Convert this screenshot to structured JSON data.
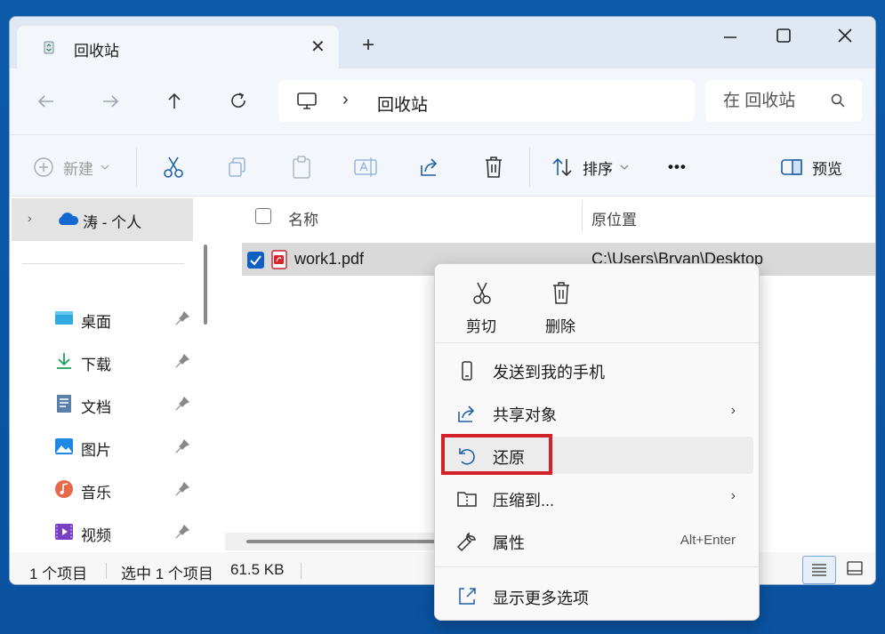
{
  "window": {
    "tab_title": "回收站",
    "tab_close": "✕",
    "new_tab": "+"
  },
  "address": {
    "crumb_sep": "›",
    "crumb": "回收站",
    "search_placeholder": "在 回收站"
  },
  "toolbar": {
    "new_label": "新建",
    "sort_label": "排序",
    "more_label": "•••",
    "preview_label": "预览"
  },
  "sidebar": {
    "onedrive_label": "涛 - 个人",
    "items": [
      {
        "label": "桌面",
        "icon": "desktop-icon"
      },
      {
        "label": "下载",
        "icon": "download-icon"
      },
      {
        "label": "文档",
        "icon": "documents-icon"
      },
      {
        "label": "图片",
        "icon": "pictures-icon"
      },
      {
        "label": "音乐",
        "icon": "music-icon"
      },
      {
        "label": "视频",
        "icon": "videos-icon"
      }
    ]
  },
  "columns": {
    "name": "名称",
    "original_location": "原位置"
  },
  "files": [
    {
      "name": "work1.pdf",
      "location": "C:\\Users\\Bryan\\Desktop",
      "selected": true
    }
  ],
  "status": {
    "item_count": "1 个项目",
    "selection": "选中 1 个项目",
    "size": "61.5 KB"
  },
  "context_menu": {
    "quick_actions": [
      {
        "label": "剪切",
        "icon": "scissors-icon"
      },
      {
        "label": "删除",
        "icon": "trash-icon"
      }
    ],
    "items": [
      {
        "label": "发送到我的手机",
        "icon": "phone-icon"
      },
      {
        "label": "共享对象",
        "icon": "share-icon",
        "arrow": "›"
      },
      {
        "label": "还原",
        "icon": "restore-icon"
      },
      {
        "label": "压缩到...",
        "icon": "zip-folder-icon",
        "arrow": "›"
      },
      {
        "label": "属性",
        "icon": "wrench-icon",
        "shortcut": "Alt+Enter"
      },
      {
        "label": "显示更多选项",
        "icon": "more-options-icon"
      }
    ]
  },
  "colors": {
    "accent": "#0f5fc2",
    "highlight": "#d32029",
    "desktop_bg": "#0c5aa8"
  }
}
